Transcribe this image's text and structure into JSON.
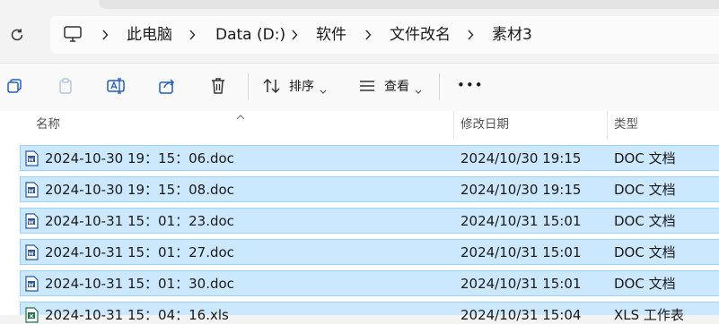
{
  "breadcrumb": {
    "items": [
      "此电脑",
      "Data (D:)",
      "软件",
      "文件改名",
      "素材3"
    ]
  },
  "toolbar": {
    "sort_label": "排序",
    "view_label": "查看",
    "more_label": "•••"
  },
  "columns": {
    "name": "名称",
    "modified": "修改日期",
    "type": "类型"
  },
  "files": [
    {
      "name": "2024-10-30 19：15：06.doc",
      "modified": "2024/10/30 19:15",
      "type": "DOC 文档",
      "icon": "word-doc-icon"
    },
    {
      "name": "2024-10-30 19：15：08.doc",
      "modified": "2024/10/30 19:15",
      "type": "DOC 文档",
      "icon": "word-doc-icon"
    },
    {
      "name": "2024-10-31 15：01：23.doc",
      "modified": "2024/10/31 15:01",
      "type": "DOC 文档",
      "icon": "word-doc-icon"
    },
    {
      "name": "2024-10-31 15：01：27.doc",
      "modified": "2024/10/31 15:01",
      "type": "DOC 文档",
      "icon": "word-doc-icon"
    },
    {
      "name": "2024-10-31 15：01：30.doc",
      "modified": "2024/10/31 15:01",
      "type": "DOC 文档",
      "icon": "word-doc-icon"
    },
    {
      "name": "2024-10-31 15：04：16.xls",
      "modified": "2024/10/31 15:04",
      "type": "XLS 工作表",
      "icon": "excel-xls-icon"
    }
  ],
  "colors": {
    "selection_fill": "#cce8ff",
    "selection_border": "#99d1ff",
    "word_blue": "#2b579a",
    "excel_green": "#217346"
  }
}
